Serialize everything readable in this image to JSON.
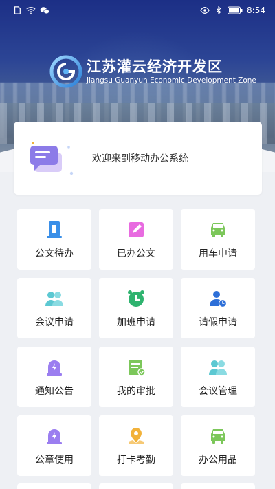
{
  "status_bar": {
    "time": "8:54",
    "left_icons": [
      "sim-icon",
      "wifi-icon",
      "wechat-icon"
    ],
    "right_icons": [
      "eye-icon",
      "bluetooth-icon",
      "battery-icon"
    ]
  },
  "header": {
    "title_cn": "江苏灌云经济开发区",
    "title_en": "Jiangsu Guanyun Economic Development Zone"
  },
  "welcome": {
    "text": "欢迎来到移动办公系统",
    "icon": "message-icon"
  },
  "tiles": [
    {
      "label": "公文待办",
      "icon": "document-pending-icon",
      "color": "#3a8fe8"
    },
    {
      "label": "已办公文",
      "icon": "document-edit-icon",
      "color": "#e86be0"
    },
    {
      "label": "用车申请",
      "icon": "car-icon",
      "color": "#7cc75a"
    },
    {
      "label": "会议申请",
      "icon": "meeting-people-icon",
      "color": "#5cc8d2"
    },
    {
      "label": "加班申请",
      "icon": "alarm-clock-icon",
      "color": "#2fb36f"
    },
    {
      "label": "请假申请",
      "icon": "person-clock-icon",
      "color": "#2d6fd8"
    },
    {
      "label": "通知公告",
      "icon": "notice-bolt-icon",
      "color": "#9b7ef0"
    },
    {
      "label": "我的审批",
      "icon": "approval-icon",
      "color": "#7cc75a"
    },
    {
      "label": "会议管理",
      "icon": "meeting-manage-icon",
      "color": "#5cc8d2"
    },
    {
      "label": "公章使用",
      "icon": "seal-icon",
      "color": "#9b7ef0"
    },
    {
      "label": "打卡考勤",
      "icon": "location-pin-icon",
      "color": "#f2b23a"
    },
    {
      "label": "办公用品",
      "icon": "supplies-car-icon",
      "color": "#7cc75a"
    }
  ]
}
